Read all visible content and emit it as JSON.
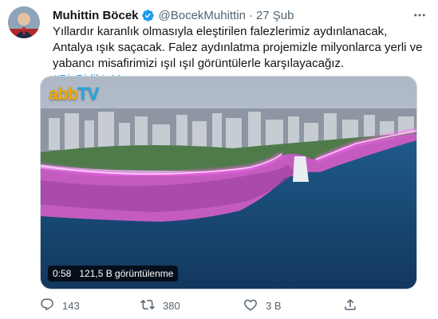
{
  "tweet": {
    "author_name": "Muhittin Böcek",
    "handle": "@BocekMuhittin",
    "separator": "·",
    "date": "27 Şub",
    "text_main": "Yıllardır karanlık olmasıyla eleştirilen falezlerimiz aydınlanacak, Antalya ışık saçacak. Falez aydınlatma projemizle milyonlarca yerli ve yabancı misafirimizi ışıl ışıl görüntülerle karşılayacağız. ",
    "hashtag": "#BizBirlikteYaparız"
  },
  "media": {
    "logo_text": "abb",
    "logo_suffix": "TV",
    "duration": "0:58",
    "views": "121,5 B görüntülenme"
  },
  "actions": {
    "replies": "143",
    "retweets": "380",
    "likes": "3 B"
  },
  "colors": {
    "accent": "#1d9bf0",
    "muted": "#536471",
    "cliff_light": "#e04fd9"
  },
  "icons": {
    "verified": "verified-badge-icon",
    "more": "more-horizontal-icon",
    "reply": "reply-icon",
    "retweet": "retweet-icon",
    "like": "heart-icon",
    "share": "share-icon"
  }
}
